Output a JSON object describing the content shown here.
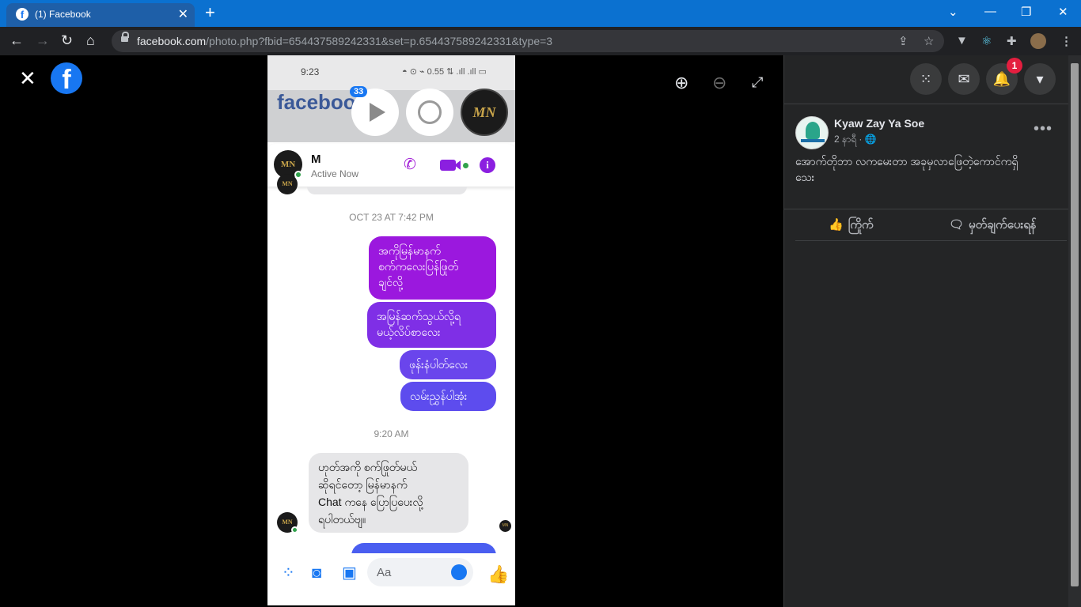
{
  "browser": {
    "tab_title": "(1) Facebook",
    "tab_close": "✕",
    "new_tab": "+",
    "url_host": "facebook.com",
    "url_path": "/photo.php?fbid=654437589242331&set=p.654437589242331&type=3",
    "win_controls": [
      "⌄",
      "—",
      "❐",
      "✕"
    ]
  },
  "viewer": {
    "close": "✕",
    "fb_logo": "f",
    "zoom_in": "⊕",
    "zoom_out": "⊖",
    "fullscreen": "⤢"
  },
  "photo": {
    "status_time": "9:23",
    "status_right": "◓ ⊙ ⌁ 0.55 ⇅ .ıll .ıll ▭",
    "fb_wordmark": "faceboo",
    "bubble_badge": "33",
    "bubble_mn": "MN",
    "chat": {
      "name": "M",
      "status": "Active Now",
      "timestamp_1": "OCT 23 AT 7:42 PM",
      "outgoing": [
        "အကိုမြန်မာနက်\nစက်ကလေးပြန်ဖြုတ်\nချင်လို့",
        "အမြန်ဆက်သွယ်လို့ရ\nမယ့်လိပ်စာလေး",
        "ဖုန်းနံပါတ်လေး",
        "လမ်းညွှန်ပါအုံး"
      ],
      "timestamp_2": "9:20 AM",
      "incoming": "ဟုတ်အကို စက်ဖြုတ်မယ်\nဆိုရင်တော့ မြန်မာနက်\nChat ကနေ ပြောပြပေးလို့\nရပါတယ်ဗျ။",
      "composer_placeholder": "Aa"
    }
  },
  "panel": {
    "notifications_count": "1",
    "author": "Kyaw Zay Ya Soe",
    "post_time": "2 နာရီ · 🌐",
    "more": "•••",
    "post_text": "အောက်တိုဘာ လကမေးတာ အခုမှလာဖြေတဲ့ကောင်ကရှိ\nသေး",
    "like_label": "ကြိုက်",
    "comment_label": "မှတ်ချက်ပေးရန်"
  },
  "colors": {
    "purple_top": "#a018e0",
    "purple_mid": "#7a3ce8",
    "blue_bottom": "#4a5ef0",
    "fb_blue": "#1877f2",
    "panel_bg": "#242526"
  }
}
